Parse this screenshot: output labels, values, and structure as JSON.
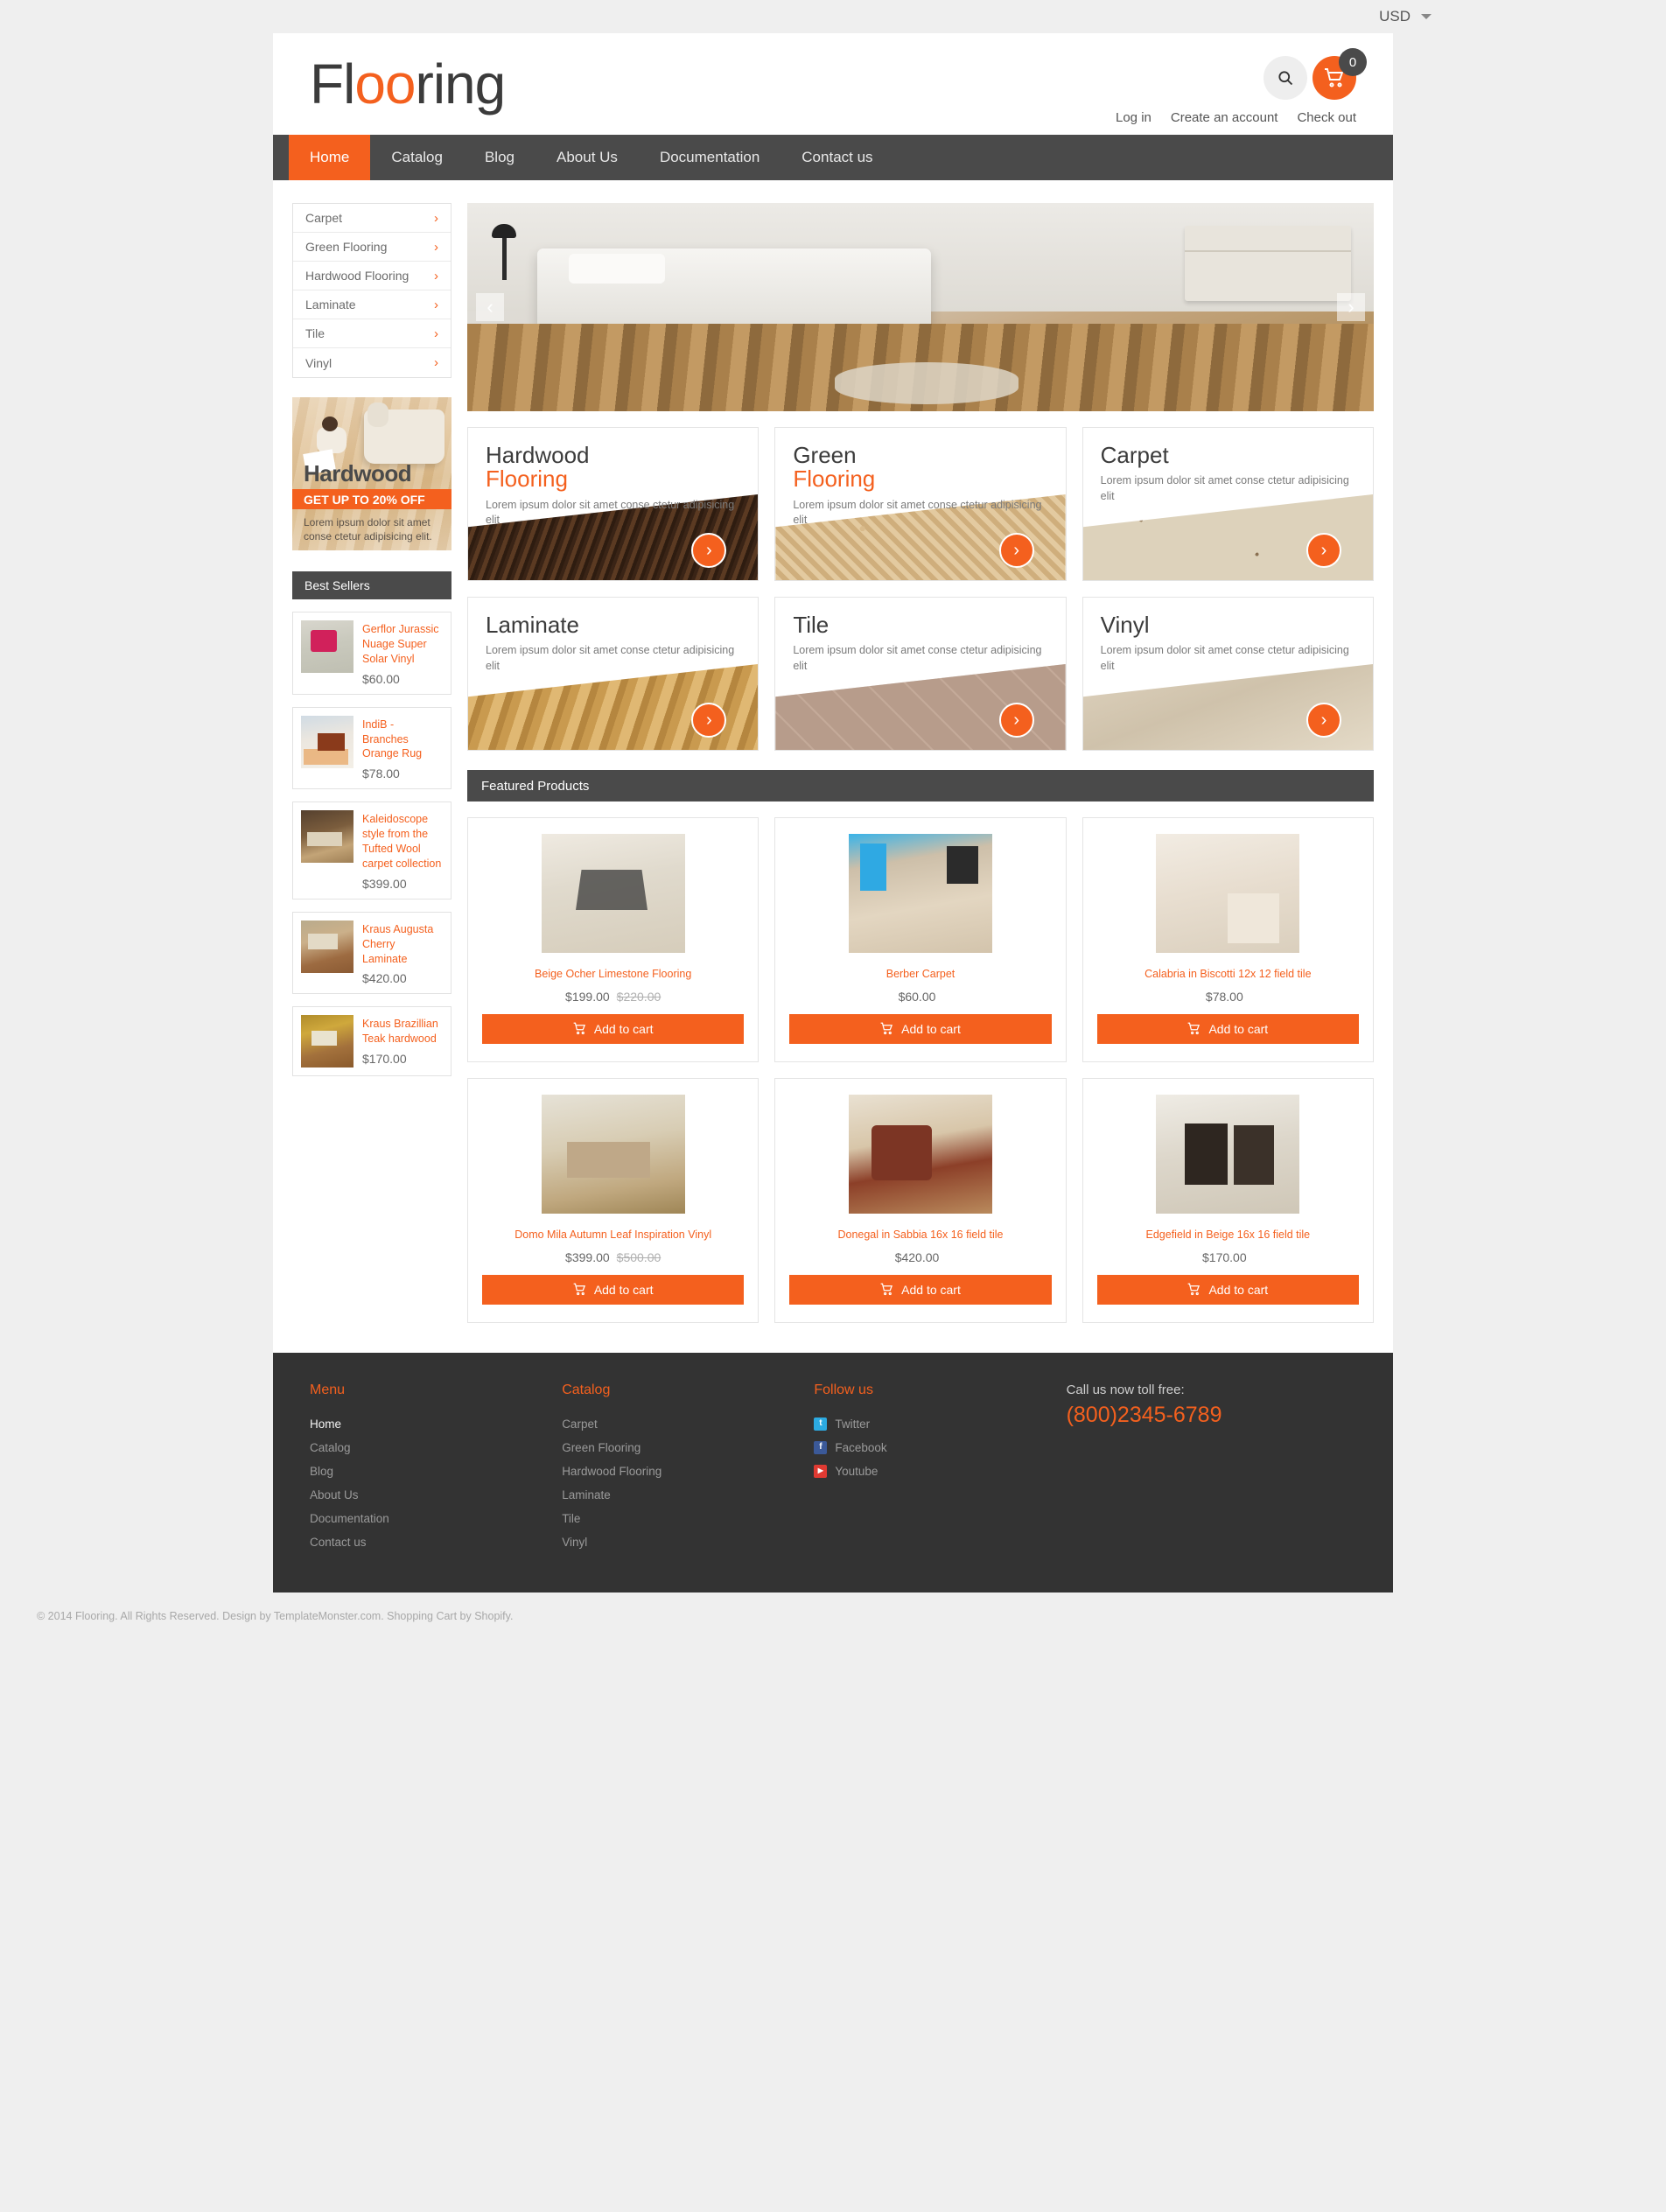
{
  "topbar": {
    "currency": "USD"
  },
  "header": {
    "logo_part1": "Fl",
    "logo_part2": "oo",
    "logo_part3": "ring",
    "cart_count": "0",
    "links": [
      {
        "label": "Log in"
      },
      {
        "label": "Create an account"
      },
      {
        "label": "Check out"
      }
    ]
  },
  "nav": [
    {
      "label": "Home",
      "active": true
    },
    {
      "label": "Catalog",
      "active": false
    },
    {
      "label": "Blog",
      "active": false
    },
    {
      "label": "About Us",
      "active": false
    },
    {
      "label": "Documentation",
      "active": false
    },
    {
      "label": "Contact us",
      "active": false
    }
  ],
  "sidebar": {
    "categories": [
      {
        "label": "Carpet"
      },
      {
        "label": "Green Flooring"
      },
      {
        "label": "Hardwood Flooring"
      },
      {
        "label": "Laminate"
      },
      {
        "label": "Tile"
      },
      {
        "label": "Vinyl"
      }
    ],
    "promo": {
      "title": "Hardwood",
      "bar": "GET UP TO 20% OFF",
      "text": "Lorem ipsum dolor sit amet conse ctetur adipisicing elit."
    },
    "bestsellers_title": "Best Sellers",
    "bestsellers": [
      {
        "name": "Gerflor Jurassic Nuage Super Solar Vinyl",
        "price": "$60.00"
      },
      {
        "name": "IndiB - Branches Orange Rug",
        "price": "$78.00"
      },
      {
        "name": "Kaleidoscope style from the Tufted Wool carpet collection",
        "price": "$399.00"
      },
      {
        "name": "Kraus Augusta Cherry Laminate",
        "price": "$420.00"
      },
      {
        "name": "Kraus Brazillian Teak hardwood",
        "price": "$170.00"
      }
    ]
  },
  "tiles": [
    {
      "title1": "Hardwood",
      "title2": "Flooring",
      "desc": "Lorem ipsum dolor sit amet conse ctetur adipisicing elit"
    },
    {
      "title1": "Green",
      "title2": "Flooring",
      "desc": "Lorem ipsum dolor sit amet conse ctetur adipisicing elit"
    },
    {
      "title1": "Carpet",
      "title2": "",
      "desc": "Lorem ipsum dolor sit amet conse ctetur adipisicing elit"
    },
    {
      "title1": "Laminate",
      "title2": "",
      "desc": "Lorem ipsum dolor sit amet conse ctetur adipisicing elit"
    },
    {
      "title1": "Tile",
      "title2": "",
      "desc": "Lorem ipsum dolor sit amet conse ctetur adipisicing elit"
    },
    {
      "title1": "Vinyl",
      "title2": "",
      "desc": "Lorem ipsum dolor sit amet conse ctetur adipisicing elit"
    }
  ],
  "featured": {
    "title": "Featured Products",
    "add_label": "Add to cart",
    "products": [
      {
        "name": "Beige Ocher Limestone Flooring",
        "price": "$199.00",
        "old_price": "$220.00"
      },
      {
        "name": "Berber Carpet",
        "price": "$60.00",
        "old_price": ""
      },
      {
        "name": "Calabria in Biscotti 12x 12 field tile",
        "price": "$78.00",
        "old_price": ""
      },
      {
        "name": "Domo Mila Autumn Leaf Inspiration Vinyl",
        "price": "$399.00",
        "old_price": "$500.00"
      },
      {
        "name": "Donegal in Sabbia 16x 16 field tile",
        "price": "$420.00",
        "old_price": ""
      },
      {
        "name": "Edgefield in Beige 16x 16 field tile",
        "price": "$170.00",
        "old_price": ""
      }
    ]
  },
  "footer": {
    "menu_title": "Menu",
    "menu": [
      {
        "label": "Home",
        "active": true
      },
      {
        "label": "Catalog",
        "active": false
      },
      {
        "label": "Blog",
        "active": false
      },
      {
        "label": "About Us",
        "active": false
      },
      {
        "label": "Documentation",
        "active": false
      },
      {
        "label": "Contact us",
        "active": false
      }
    ],
    "catalog_title": "Catalog",
    "catalog": [
      {
        "label": "Carpet"
      },
      {
        "label": "Green Flooring"
      },
      {
        "label": "Hardwood Flooring"
      },
      {
        "label": "Laminate"
      },
      {
        "label": "Tile"
      },
      {
        "label": "Vinyl"
      }
    ],
    "follow_title": "Follow us",
    "social": [
      {
        "label": "Twitter",
        "color": "#2caae1",
        "glyph": "t"
      },
      {
        "label": "Facebook",
        "color": "#3b5998",
        "glyph": "f"
      },
      {
        "label": "Youtube",
        "color": "#e03a32",
        "glyph": "▶"
      }
    ],
    "call_label": "Call us now toll free:",
    "phone": "(800)2345-6789",
    "copyright": "© 2014 Flooring. All Rights Reserved. Design by TemplateMonster.com. Shopping Cart by Shopify."
  },
  "colors": {
    "accent": "#f4601e",
    "dark": "#4a4a4a",
    "footer": "#333333"
  }
}
